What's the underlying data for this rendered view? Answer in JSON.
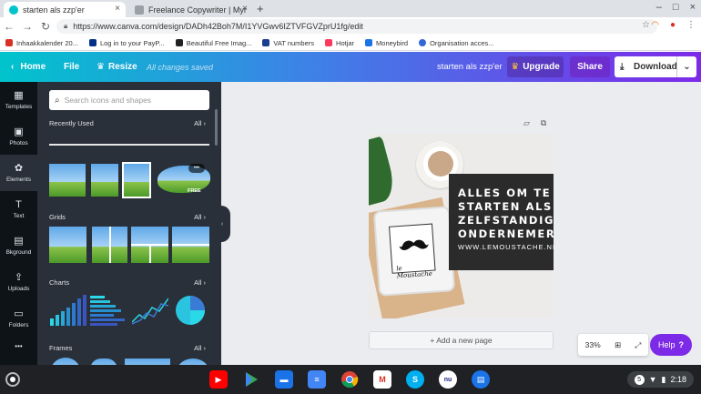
{
  "browser": {
    "tabs": [
      {
        "title": "starten als zzp'er",
        "active": true
      },
      {
        "title": "Freelance Copywriter | Myra Kot",
        "active": false
      }
    ],
    "tab_close": "×",
    "new_tab": "+",
    "window_buttons": [
      "–",
      "□",
      "×"
    ],
    "url": "https://www.canva.com/design/DADh42Boh7M/I1YVGwv6IZTVFGVZprU1fg/edit",
    "bookmarks": [
      {
        "label": "Inhaakkalender 20...",
        "color": "#d93025"
      },
      {
        "label": "Log in to your PayP...",
        "color": "#003087"
      },
      {
        "label": "Beautiful Free Imag...",
        "color": "#222222"
      },
      {
        "label": "VAT numbers",
        "color": "#1a3d8f"
      },
      {
        "label": "Hotjar",
        "color": "#fd3a5c"
      },
      {
        "label": "Moneybird",
        "color": "#1a73e8"
      },
      {
        "label": "Organisation acces...",
        "color": "#3367d6"
      }
    ]
  },
  "canva": {
    "header": {
      "home": "Home",
      "file": "File",
      "resize": "Resize",
      "saved_status": "All changes saved",
      "design_title": "starten als zzp'er",
      "upgrade": "Upgrade",
      "share": "Share",
      "download": "Download"
    },
    "rail": [
      {
        "label": "Templates",
        "icon": "▦"
      },
      {
        "label": "Photos",
        "icon": "▣"
      },
      {
        "label": "Elements",
        "icon": "✿"
      },
      {
        "label": "Text",
        "icon": "T"
      },
      {
        "label": "Bkground",
        "icon": "▤"
      },
      {
        "label": "Uploads",
        "icon": "⇪"
      },
      {
        "label": "Folders",
        "icon": "▭"
      },
      {
        "label": "",
        "icon": "•••"
      }
    ],
    "panel": {
      "search_placeholder": "Search icons and shapes",
      "sections": [
        {
          "title": "Recently Used",
          "all": "All  ›"
        },
        {
          "title": "Grids",
          "all": "All  ›"
        },
        {
          "title": "Charts",
          "all": "All  ›"
        },
        {
          "title": "Frames",
          "all": "All  ›"
        }
      ],
      "free_badge": "FREE",
      "more": "•••"
    },
    "design": {
      "lines": [
        "ALLES OM TE",
        "STARTEN ALS",
        "ZELFSTANDIG",
        "ONDERNEMER"
      ],
      "url": "WWW.LEMOUSTACHE.NL",
      "signature": "le Moustache"
    },
    "add_page": "+ Add a new page",
    "zoom": "33%",
    "help": "Help"
  },
  "os": {
    "time": "2:18",
    "tray_badge": "5"
  }
}
